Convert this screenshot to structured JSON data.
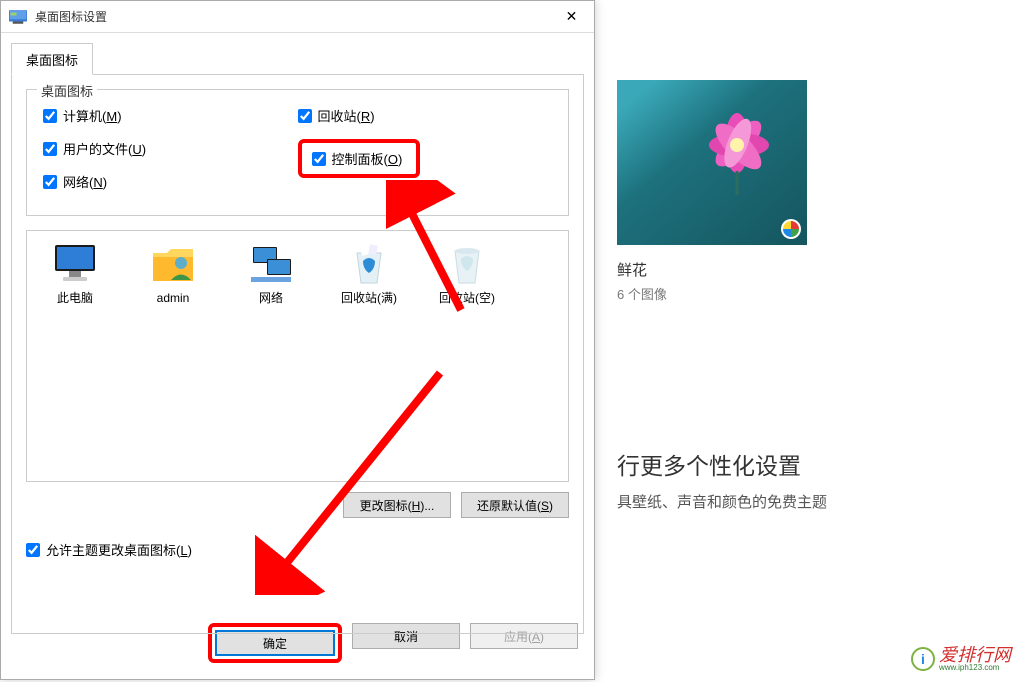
{
  "dialog": {
    "title": "桌面图标设置",
    "tab": "桌面图标",
    "group_title": "桌面图标",
    "checks": {
      "computer": {
        "label": "计算机(",
        "key": "M",
        "suffix": ")"
      },
      "userfiles": {
        "label": "用户的文件(",
        "key": "U",
        "suffix": ")"
      },
      "network": {
        "label": "网络(",
        "key": "N",
        "suffix": ")"
      },
      "recyclebin": {
        "label": "回收站(",
        "key": "R",
        "suffix": ")"
      },
      "controlpanel": {
        "label": "控制面板(",
        "key": "O",
        "suffix": ")"
      }
    },
    "icons": [
      {
        "name": "此电脑"
      },
      {
        "name": "admin"
      },
      {
        "name": "网络"
      },
      {
        "name": "回收站(满)"
      },
      {
        "name": "回收站(空)"
      }
    ],
    "change_icon_btn": "更改图标(H)...",
    "restore_default_btn": "还原默认值(S)",
    "allow_theme_label": "允许主题更改桌面图标(",
    "allow_theme_key": "L",
    "allow_theme_suffix": ")",
    "ok_btn": "确定",
    "cancel_btn": "取消",
    "apply_btn_prefix": "应用(",
    "apply_btn_key": "A",
    "apply_btn_suffix": ")"
  },
  "right": {
    "thumb_title": "鲜花",
    "thumb_sub": "6 个图像",
    "big_text": "行更多个性化设置",
    "sub_text": "具壁纸、声音和颜色的免费主题"
  },
  "watermark": {
    "name": "爱排行网",
    "url": "www.iph123.com"
  }
}
